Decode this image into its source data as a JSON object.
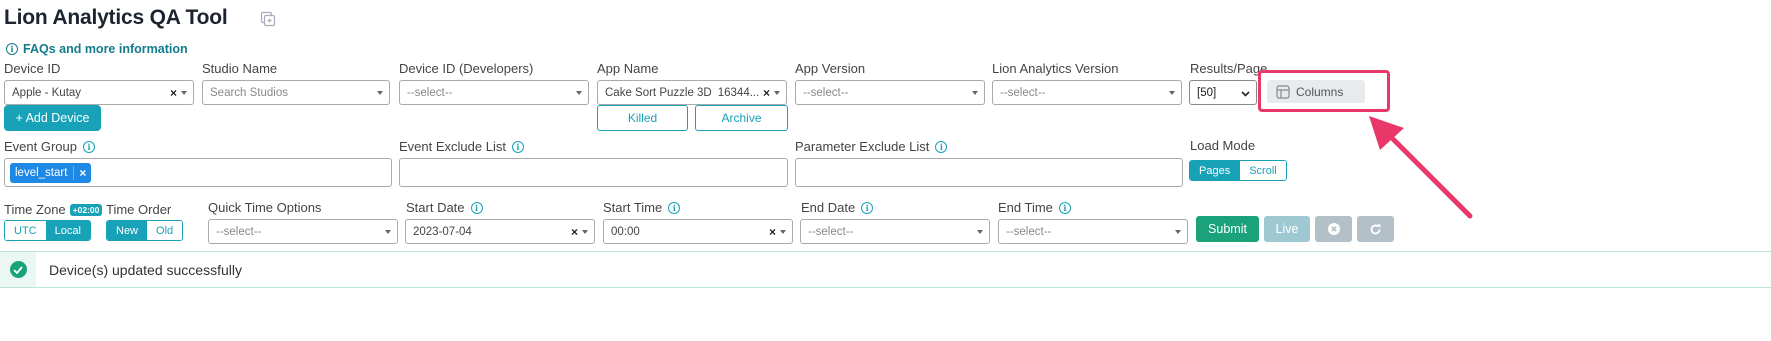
{
  "header": {
    "title": "Lion Analytics QA Tool",
    "faq_link": "FAQs and more information"
  },
  "filters_row1": {
    "device_id": {
      "label": "Device ID",
      "value": "Apple - Kutay"
    },
    "add_device": "+ Add Device",
    "studio_name": {
      "label": "Studio Name",
      "placeholder": "Search Studios"
    },
    "device_id_dev": {
      "label": "Device ID (Developers)",
      "placeholder": "--select--"
    },
    "app_name": {
      "label": "App Name",
      "value": "Cake Sort Puzzle 3D",
      "suffix": "16344..."
    },
    "killed": "Killed",
    "archive": "Archive",
    "app_version": {
      "label": "App Version",
      "placeholder": "--select--"
    },
    "lion_version": {
      "label": "Lion Analytics Version",
      "placeholder": "--select--"
    },
    "results_page": {
      "label": "Results/Page",
      "value": "[50]"
    },
    "columns": "Columns"
  },
  "filters_row2": {
    "event_group": {
      "label": "Event Group",
      "tags": [
        "level_start"
      ]
    },
    "event_exclude": {
      "label": "Event Exclude List"
    },
    "param_exclude": {
      "label": "Parameter Exclude List"
    },
    "load_mode": {
      "label": "Load Mode",
      "options": [
        "Pages",
        "Scroll"
      ],
      "selected": "Pages"
    }
  },
  "filters_row3": {
    "time_zone": {
      "label": "Time Zone",
      "badge": "+02:00",
      "options": [
        "UTC",
        "Local"
      ],
      "selected": "Local"
    },
    "time_order": {
      "label": "Time Order",
      "options": [
        "New",
        "Old"
      ],
      "selected": "New"
    },
    "quick_time": {
      "label": "Quick Time Options",
      "placeholder": "--select--"
    },
    "start_date": {
      "label": "Start Date",
      "value": "2023-07-04"
    },
    "start_time": {
      "label": "Start Time",
      "value": "00:00"
    },
    "end_date": {
      "label": "End Date",
      "placeholder": "--select--"
    },
    "end_time": {
      "label": "End Time",
      "placeholder": "--select--"
    },
    "submit": "Submit",
    "live": "Live"
  },
  "alert": {
    "message": "Device(s) updated successfully"
  },
  "colors": {
    "teal": "#17a2b8",
    "green": "#1aa37a",
    "highlight": "#e8386a",
    "tag_blue": "#1e88e5"
  },
  "icons": [
    "copy-icon",
    "info-icon",
    "columns-icon",
    "apple-icon",
    "close-circle-icon",
    "refresh-icon",
    "check-circle-icon",
    "pointer-arrow"
  ]
}
